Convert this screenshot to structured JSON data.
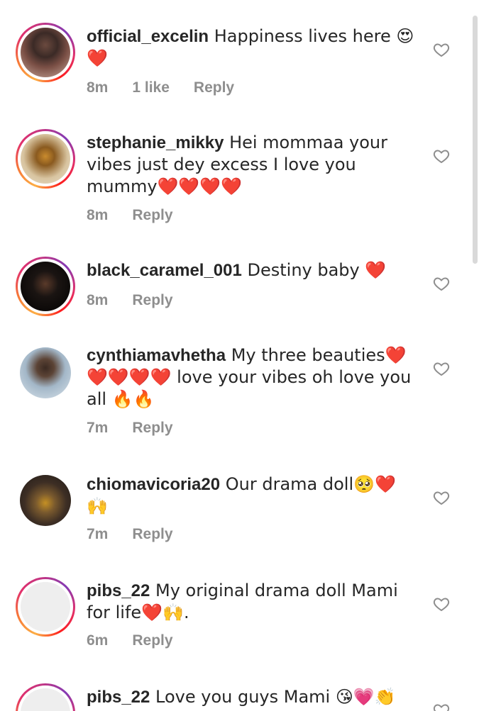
{
  "comments": [
    {
      "username": "official_excelin",
      "text": " Happiness lives here 😍 ❤️",
      "time": "8m",
      "likes": "1 like",
      "reply": "Reply",
      "avatar": "story"
    },
    {
      "username": "stephanie_mikky",
      "text": " Hei mommaa your vibes just dey excess I love you mummy❤️❤️❤️❤️",
      "time": "8m",
      "likes": "",
      "reply": "Reply",
      "avatar": "story"
    },
    {
      "username": "black_caramel_001",
      "text": " Destiny baby ❤️",
      "time": "8m",
      "likes": "",
      "reply": "Reply",
      "avatar": "story"
    },
    {
      "username": "cynthiamavhetha",
      "text": " My three beauties❤️❤️❤️❤️❤️ love your vibes oh love you all 🔥🔥",
      "time": "7m",
      "likes": "",
      "reply": "Reply",
      "avatar": "plain"
    },
    {
      "username": "chiomavicoria20",
      "text": " Our drama doll🥺❤️🙌",
      "time": "7m",
      "likes": "",
      "reply": "Reply",
      "avatar": "plain"
    },
    {
      "username": "pibs_22",
      "text": " My original drama doll Mami for life❤️🙌.",
      "time": "6m",
      "likes": "",
      "reply": "Reply",
      "avatar": "story"
    },
    {
      "username": "pibs_22",
      "text": " Love you guys Mami 😘💗👏",
      "time": "",
      "likes": "",
      "reply": "",
      "avatar": "story"
    }
  ],
  "icons": {
    "like": "heart-outline-icon"
  },
  "colors": {
    "text": "#262626",
    "meta": "#8e8e8e",
    "heart_outline": "#8e8e8e"
  }
}
